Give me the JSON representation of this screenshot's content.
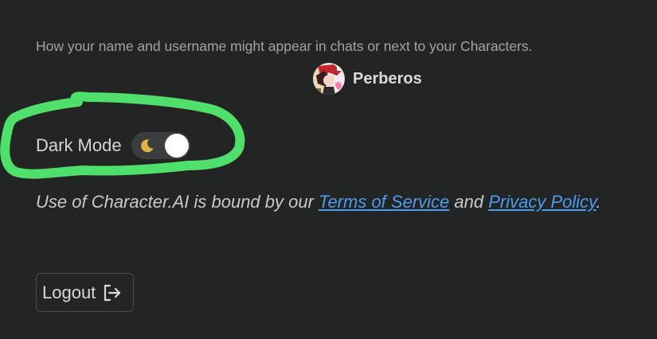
{
  "profile": {
    "hint": "How your name and username might appear in chats or next to your Characters.",
    "preview_name": "Perberos",
    "avatar_icon": "character-avatar"
  },
  "dark_mode": {
    "label": "Dark Mode",
    "enabled": true,
    "icon": "moon-icon",
    "highlight_color": "#4ee06a"
  },
  "legal": {
    "prefix": "Use of Character.AI is bound by our ",
    "terms_label": "Terms of Service",
    "middle": " and ",
    "privacy_label": "Privacy Policy",
    "suffix": "."
  },
  "logout": {
    "label": "Logout",
    "icon": "logout-icon"
  },
  "colors": {
    "background": "#232424",
    "link": "#4d9bf0"
  }
}
